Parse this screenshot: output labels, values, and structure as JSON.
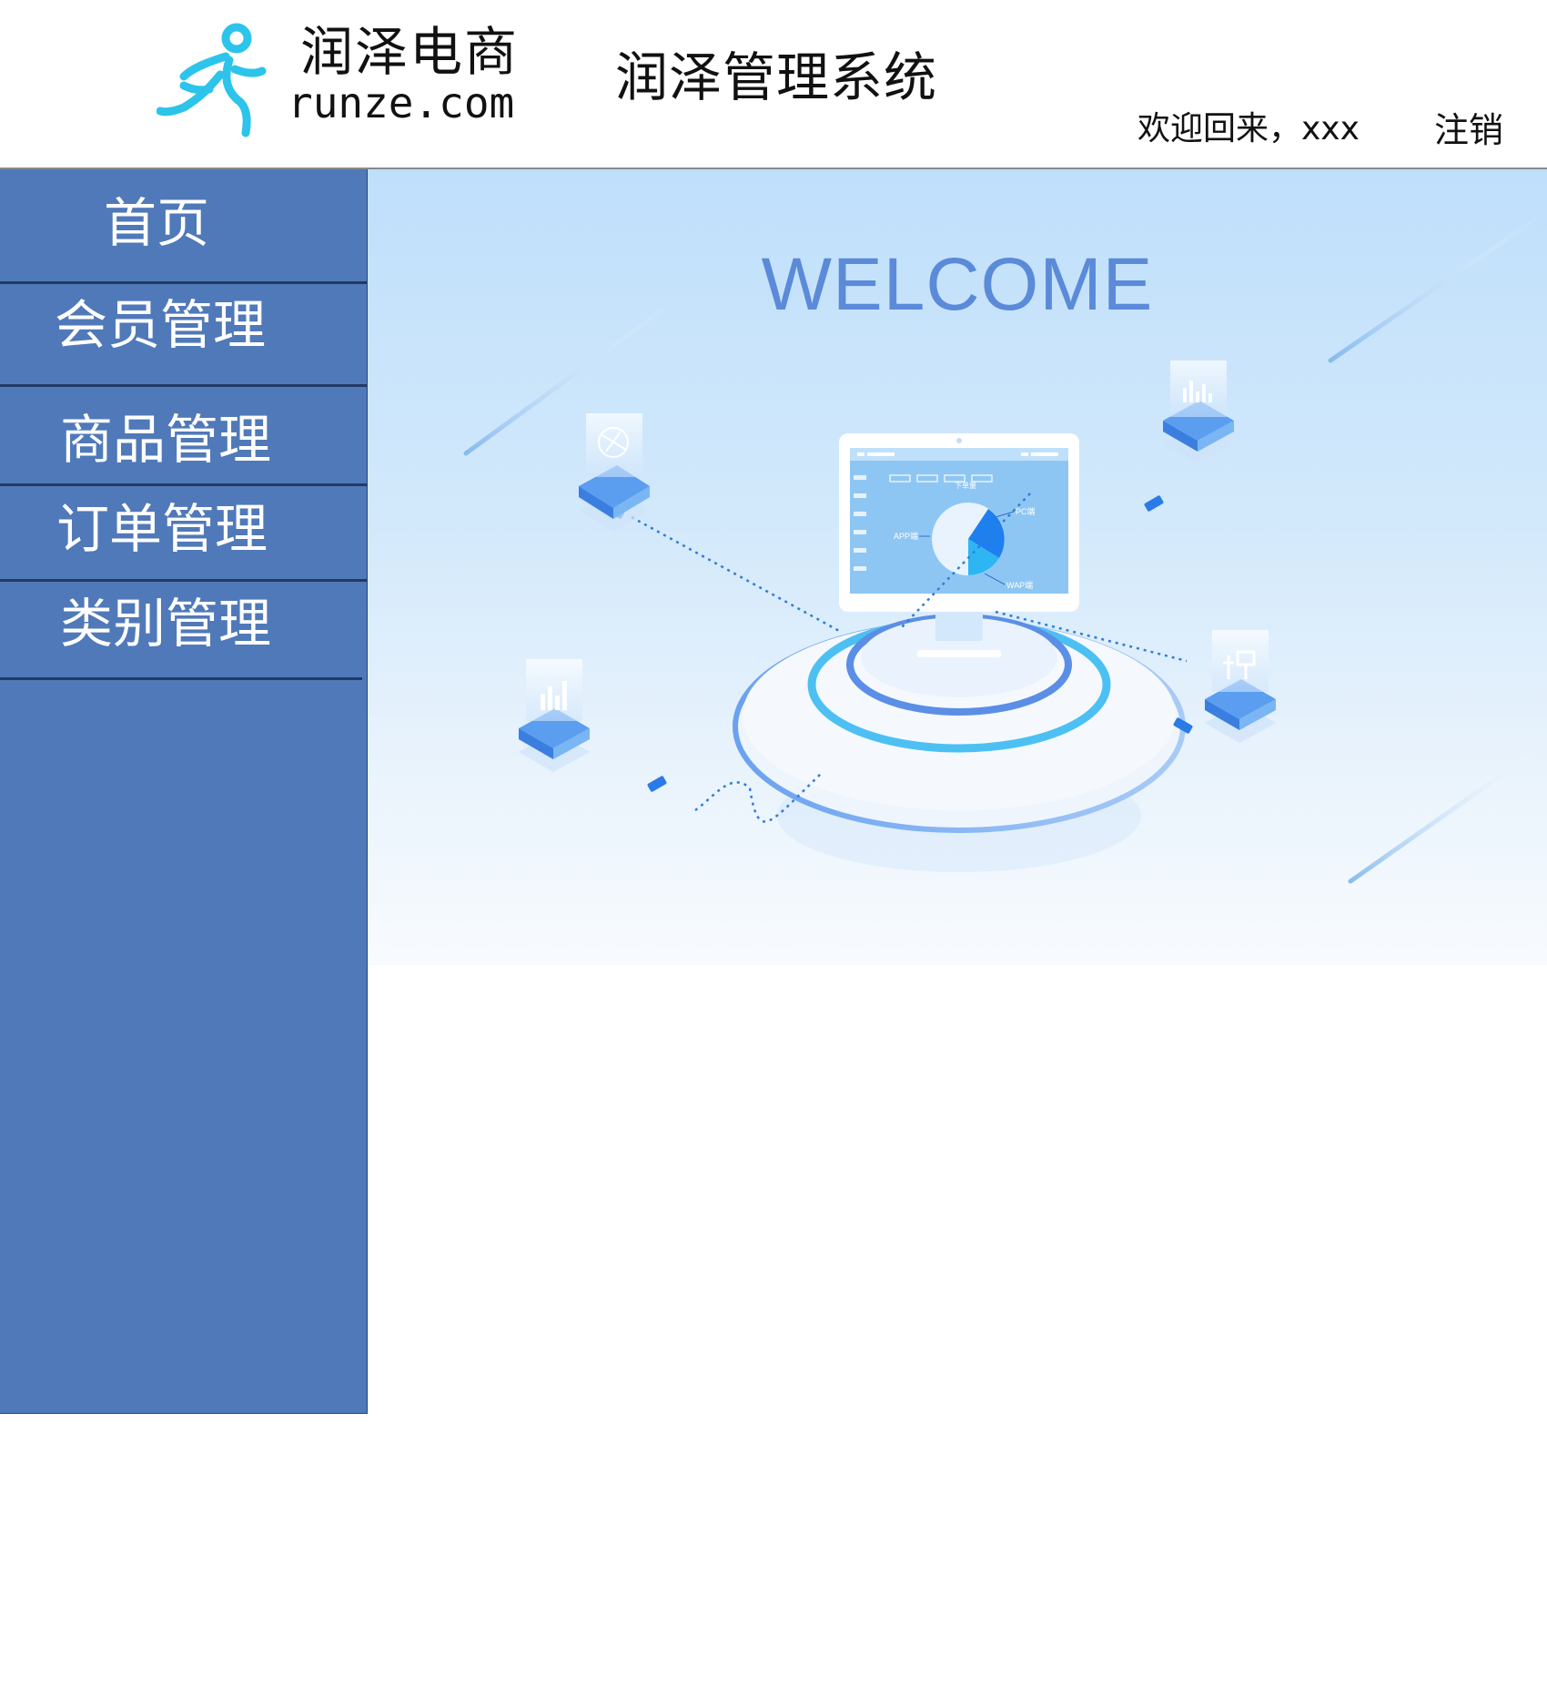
{
  "header": {
    "brand_cn": "润泽电商",
    "brand_en": "runze.com",
    "system_title": "润泽管理系统",
    "welcome_text": "欢迎回来，xxx",
    "logout_label": "注销"
  },
  "sidebar": {
    "items": [
      {
        "label": "首页"
      },
      {
        "label": "会员管理"
      },
      {
        "label": "商品管理"
      },
      {
        "label": "订单管理"
      },
      {
        "label": "类别管理"
      }
    ]
  },
  "main": {
    "welcome_heading": "WELCOME",
    "illustration": {
      "monitor_pie_labels": [
        "PC端",
        "APP端",
        "WAP端"
      ],
      "monitor_title": "下单量"
    }
  },
  "colors": {
    "sidebar_bg": "#5079b9",
    "accent_blue": "#5b8ad8",
    "logo_cyan": "#2cc4ea"
  },
  "icons": [
    "runner-logo-icon",
    "network-cube-icon",
    "bar-chart-cube-icon",
    "chart-cube-icon",
    "control-cube-icon"
  ]
}
